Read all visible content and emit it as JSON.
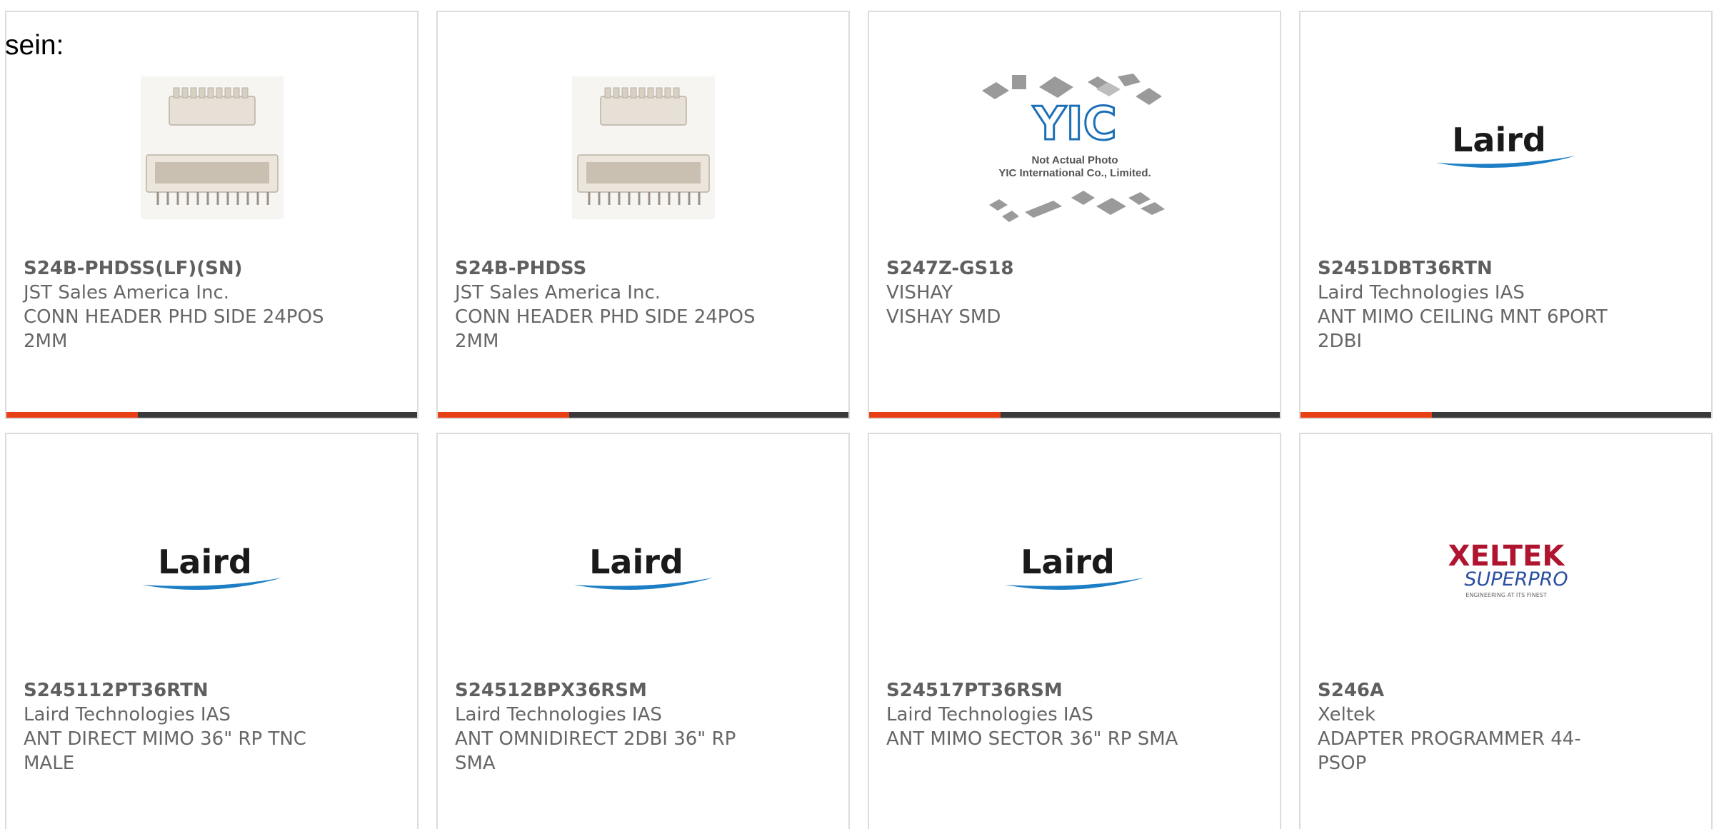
{
  "intro_text": "sein:",
  "colors": {
    "accent_bar": "#e84118",
    "bar_dark": "#3a3a3a",
    "text": "#666666",
    "laird_blue": "#1c7ec4",
    "xeltek_red": "#b01530",
    "xeltek_blue": "#2a4fa0"
  },
  "products": [
    {
      "part_number": "S24B-PHDSS(LF)(SN)",
      "manufacturer": "JST Sales America Inc.",
      "description": "CONN HEADER PHD SIDE 24POS 2MM",
      "image": "connector-photo"
    },
    {
      "part_number": "S24B-PHDSS",
      "manufacturer": "JST Sales America Inc.",
      "description": "CONN HEADER PHD SIDE 24POS 2MM",
      "image": "connector-photo"
    },
    {
      "part_number": "S247Z-GS18",
      "manufacturer": "VISHAY",
      "description": "VISHAY SMD",
      "image": "yic-placeholder",
      "image_text": {
        "logo": "YIC",
        "line1": "Not Actual Photo",
        "line2": "YIC International Co., Limited."
      }
    },
    {
      "part_number": "S2451DBT36RTN",
      "manufacturer": "Laird Technologies IAS",
      "description": "ANT MIMO CEILING MNT 6PORT 2DBI",
      "image": "laird-logo",
      "image_text": {
        "logo": "Laird"
      }
    },
    {
      "part_number": "S245112PT36RTN",
      "manufacturer": "Laird Technologies IAS",
      "description": "ANT DIRECT MIMO 36\" RP TNC MALE",
      "image": "laird-logo",
      "image_text": {
        "logo": "Laird"
      }
    },
    {
      "part_number": "S24512BPX36RSM",
      "manufacturer": "Laird Technologies IAS",
      "description": "ANT OMNIDIRECT 2DBI 36\" RP SMA",
      "image": "laird-logo",
      "image_text": {
        "logo": "Laird"
      }
    },
    {
      "part_number": "S24517PT36RSM",
      "manufacturer": "Laird Technologies IAS",
      "description": "ANT MIMO SECTOR 36\" RP SMA",
      "image": "laird-logo",
      "image_text": {
        "logo": "Laird"
      }
    },
    {
      "part_number": "S246A",
      "manufacturer": "Xeltek",
      "description": "ADAPTER PROGRAMMER 44-PSOP",
      "image": "xeltek-logo",
      "image_text": {
        "logo_top": "XELTEK",
        "logo_bottom": "SUPERPRO",
        "tagline": "ENGINEERING AT ITS FINEST"
      }
    }
  ]
}
